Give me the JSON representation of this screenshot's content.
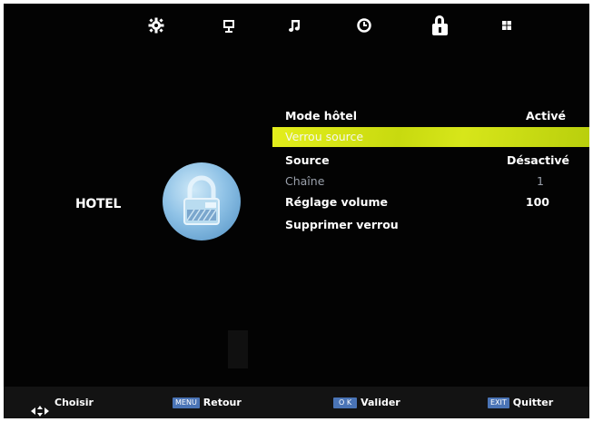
{
  "top_icons": [
    {
      "name": "settings-icon",
      "glyph": "⚙"
    },
    {
      "name": "picture-icon",
      "glyph": "🖵"
    },
    {
      "name": "sound-icon",
      "glyph": "♫"
    },
    {
      "name": "timer-icon",
      "glyph": "◷"
    },
    {
      "name": "lock-icon",
      "glyph": ""
    },
    {
      "name": "apps-icon",
      "glyph": "▦"
    }
  ],
  "section": {
    "title": "HOTEL"
  },
  "menu": {
    "items": [
      {
        "label": "Mode hôtel",
        "value": "Activé"
      },
      {
        "label": "Verrou source",
        "value": ""
      },
      {
        "label": "Source",
        "value": "Désactivé"
      },
      {
        "label": "Chaîne",
        "value": "1"
      },
      {
        "label": "Réglage volume",
        "value": "100"
      },
      {
        "label": "Supprimer verrou",
        "value": ""
      }
    ],
    "selected_index": 1
  },
  "help": {
    "navigate": {
      "icon": "arrows-icon",
      "label": "Choisir"
    },
    "back": {
      "key": "MENU",
      "label": "Retour"
    },
    "ok": {
      "key": "O K",
      "label": "Valider"
    },
    "exit": {
      "key": "EXIT",
      "label": "Quitter"
    }
  },
  "colors": {
    "highlight": "#d7e61a",
    "key_badge": "#4a74b6",
    "background": "#030303",
    "dim_text": "#9aa0ab"
  }
}
